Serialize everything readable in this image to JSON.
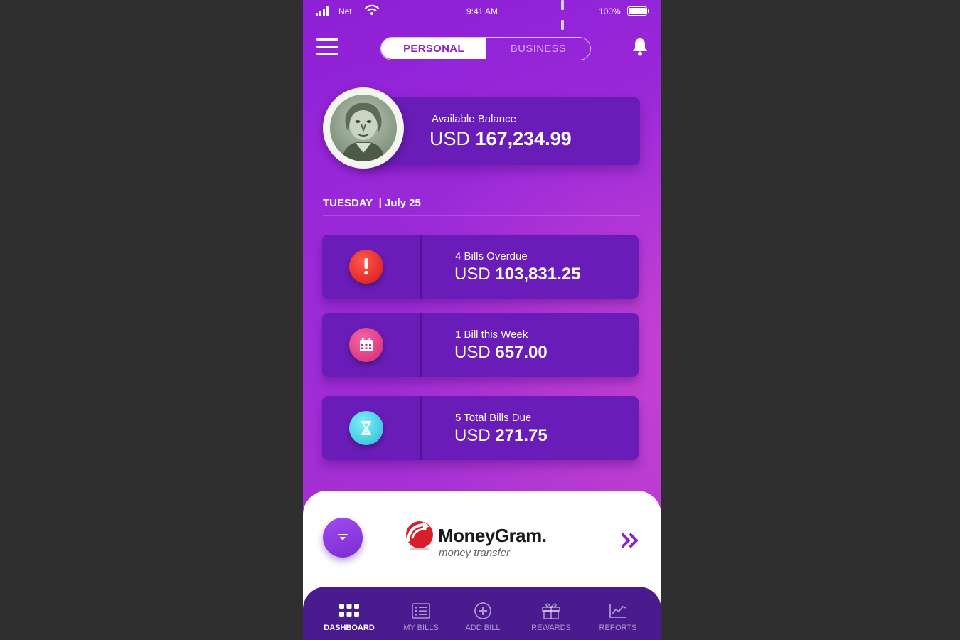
{
  "status_bar": {
    "carrier": "Net.",
    "time": "9:41 AM",
    "battery": "100%"
  },
  "header": {
    "tabs": [
      "PERSONAL",
      "BUSINESS"
    ],
    "active_tab": "PERSONAL"
  },
  "balance": {
    "label": "Available Balance",
    "currency": "USD",
    "amount": "167,234.99"
  },
  "date": {
    "day": "TUESDAY",
    "date": "| July 25"
  },
  "bills": [
    {
      "label": "4 Bills Overdue",
      "currency": "USD",
      "amount": "103,831.25",
      "icon": "alert-icon",
      "color": "#e8272f"
    },
    {
      "label": "1 Bill this Week",
      "currency": "USD",
      "amount": "657.00",
      "icon": "calendar-icon",
      "color": "#e0357e"
    },
    {
      "label": "5 Total Bills Due",
      "currency": "USD",
      "amount": "271.75",
      "icon": "hourglass-icon",
      "color": "#3ecde0"
    }
  ],
  "promo": {
    "brand": "MoneyGram.",
    "tagline": "money transfer"
  },
  "nav": [
    {
      "label": "DASHBOARD",
      "icon": "grid-icon",
      "active": true
    },
    {
      "label": "MY BILLS",
      "icon": "list-icon",
      "active": false
    },
    {
      "label": "ADD BILL",
      "icon": "plus-circle-icon",
      "active": false
    },
    {
      "label": "REWARDS",
      "icon": "gift-icon",
      "active": false
    },
    {
      "label": "REPORTS",
      "icon": "chart-icon",
      "active": false
    }
  ],
  "colors": {
    "accent": "#8a24c9",
    "card": "#6a1cb8",
    "nav": "#4a1a8f"
  }
}
